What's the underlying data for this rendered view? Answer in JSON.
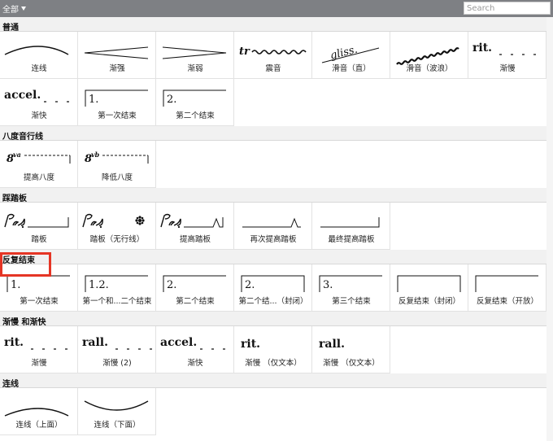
{
  "toolbar": {
    "filter_label": "全部",
    "search_placeholder": "Search"
  },
  "sections": [
    {
      "title": "普通",
      "items": [
        {
          "label": "连线",
          "icon": "slur-icon"
        },
        {
          "label": "渐强",
          "icon": "crescendo-icon"
        },
        {
          "label": "渐弱",
          "icon": "diminuendo-icon"
        },
        {
          "label": "震音",
          "icon": "trill-icon",
          "text": "tr"
        },
        {
          "label": "滑音（直）",
          "icon": "glissando-straight-icon",
          "text": "gliss."
        },
        {
          "label": "滑音（波浪）",
          "icon": "glissando-wavy-icon"
        },
        {
          "label": "渐慢",
          "icon": "ritardando-icon",
          "text": "rit."
        },
        {
          "label": "渐快",
          "icon": "accelerando-icon",
          "text": "accel."
        },
        {
          "label": "第一次结束",
          "icon": "volta-1-icon",
          "text": "1."
        },
        {
          "label": "第二个结束",
          "icon": "volta-2-icon",
          "text": "2."
        }
      ]
    },
    {
      "title": "八度音行线",
      "items": [
        {
          "label": "提高八度",
          "icon": "ottava-alta-icon",
          "text": "8",
          "sup": "va"
        },
        {
          "label": "降低八度",
          "icon": "ottava-bassa-icon",
          "text": "8",
          "sup": "vb"
        }
      ]
    },
    {
      "title": "踩踏板",
      "items": [
        {
          "label": "踏板",
          "icon": "pedal-line-icon"
        },
        {
          "label": "踏板（无行线）",
          "icon": "pedal-star-icon"
        },
        {
          "label": "提高踏板",
          "icon": "pedal-change-icon"
        },
        {
          "label": "再次提高踏板",
          "icon": "pedal-repeat-change-icon"
        },
        {
          "label": "最终提高踏板",
          "icon": "pedal-final-change-icon"
        }
      ]
    },
    {
      "title": "反复结束",
      "items": [
        {
          "label": "第一次结束",
          "icon": "volta-1-icon",
          "text": "1."
        },
        {
          "label": "第一个和...二个结束",
          "icon": "volta-1-2-icon",
          "text": "1.2."
        },
        {
          "label": "第二个结束",
          "icon": "volta-2-icon",
          "text": "2."
        },
        {
          "label": "第二个结...（封闭）",
          "icon": "volta-2-closed-icon",
          "text": "2."
        },
        {
          "label": "第三个结束",
          "icon": "volta-3-icon",
          "text": "3."
        },
        {
          "label": "反复结束（封闭）",
          "icon": "volta-closed-icon"
        },
        {
          "label": "反复结束（开放）",
          "icon": "volta-open-icon"
        }
      ]
    },
    {
      "title": "渐慢 和渐快",
      "items": [
        {
          "label": "渐慢",
          "icon": "ritardando-icon",
          "text": "rit."
        },
        {
          "label": "渐慢 (2)",
          "icon": "rallentando-icon",
          "text": "rall."
        },
        {
          "label": "渐快",
          "icon": "accelerando-icon",
          "text": "accel."
        },
        {
          "label": "渐慢 （仅文本）",
          "icon": "ritardando-text-icon",
          "text": "rit."
        },
        {
          "label": "渐慢 （仅文本）",
          "icon": "rallentando-text-icon",
          "text": "rall."
        }
      ]
    },
    {
      "title": "连线",
      "items": [
        {
          "label": "连线（上面）",
          "icon": "slur-above-icon"
        },
        {
          "label": "连线（下面）",
          "icon": "slur-below-icon"
        }
      ]
    }
  ]
}
